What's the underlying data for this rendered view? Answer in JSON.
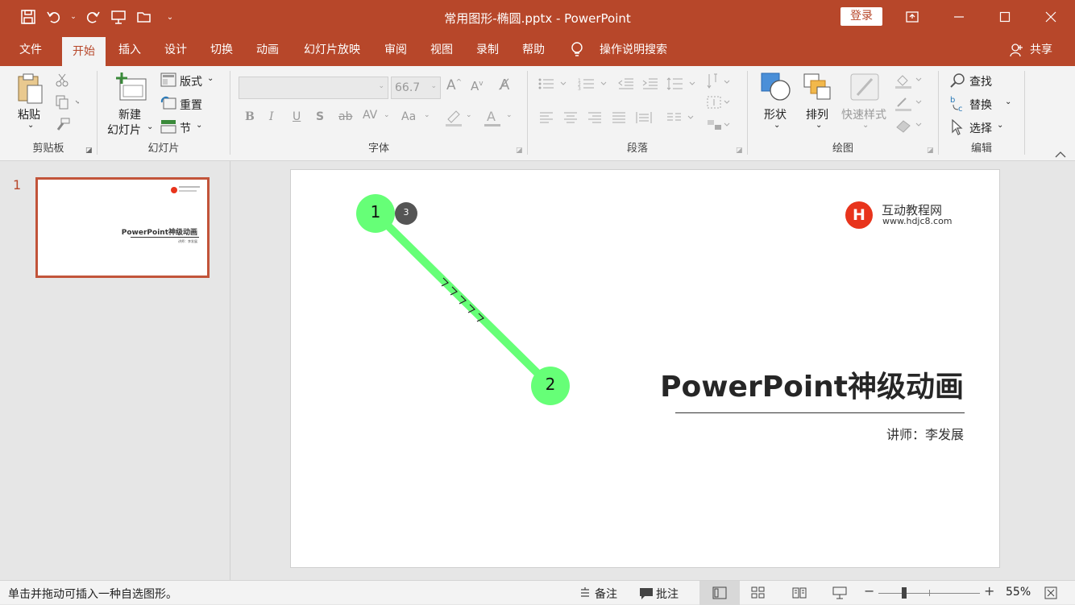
{
  "window": {
    "title": "常用图形-椭圆.pptx  -  PowerPoint",
    "login": "登录"
  },
  "tabs": [
    "文件",
    "开始",
    "插入",
    "设计",
    "切换",
    "动画",
    "幻灯片放映",
    "审阅",
    "视图",
    "录制",
    "帮助"
  ],
  "active_tab": "开始",
  "tellme": "操作说明搜索",
  "share": "共享",
  "ribbon": {
    "clipboard": {
      "label": "剪贴板",
      "paste": "粘贴"
    },
    "slides": {
      "label": "幻灯片",
      "new_slide_1": "新建",
      "new_slide_2": "幻灯片",
      "layout": "版式",
      "reset": "重置",
      "section": "节"
    },
    "font": {
      "label": "字体",
      "size": "66.7",
      "bold": "B",
      "italic": "I",
      "underline": "U",
      "shadow": "S",
      "strike": "ab",
      "spacing": "AV",
      "case": "Aa",
      "color": "A"
    },
    "paragraph": {
      "label": "段落"
    },
    "drawing": {
      "label": "绘图",
      "shapes": "形状",
      "arrange": "排列",
      "quick_styles": "快速样式"
    },
    "editing": {
      "label": "编辑",
      "find": "查找",
      "replace": "替换",
      "select": "选择"
    }
  },
  "thumb": {
    "number": "1",
    "title": "PowerPoint神级动画",
    "subtitle": "讲师：李发展"
  },
  "slide": {
    "logo_letter": "H",
    "logo_name": "互动教程网",
    "logo_url": "www.hdjc8.com",
    "title": "PowerPoint神级动画",
    "subtitle": "讲师：李发展",
    "anim_start": "1",
    "anim_end": "2",
    "anim_badge": "3"
  },
  "statusbar": {
    "hint": "单击并拖动可插入一种自选图形。",
    "notes": "备注",
    "comments": "批注",
    "zoom": "55%"
  },
  "colors": {
    "accent": "#b7472a",
    "path_green": "#66ff77",
    "logo_red": "#e8341c"
  }
}
